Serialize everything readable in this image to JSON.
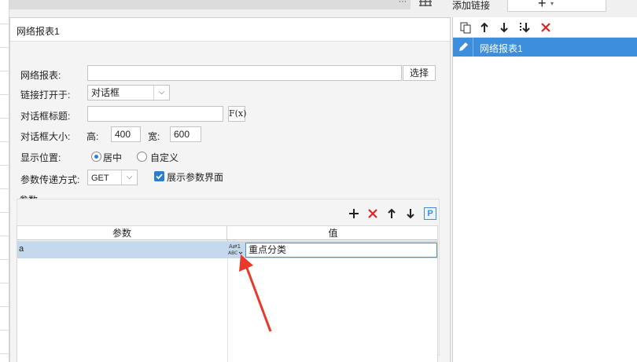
{
  "dialog": {
    "title": "网络报表1"
  },
  "form": {
    "report_label": "网络报表:",
    "report_value": "",
    "choose_button": "选择",
    "open_in_label": "链接打开于:",
    "open_in_value": "对话框",
    "dialog_title_label": "对话框标题:",
    "dialog_title_value": "",
    "fx_label": "F(x)",
    "dialog_size_label": "对话框大小:",
    "height_label": "高:",
    "height_value": "400",
    "width_label": "宽:",
    "width_value": "600",
    "position_label": "显示位置:",
    "position_center": "居中",
    "position_custom": "自定义",
    "param_method_label": "参数传递方式:",
    "param_method_value": "GET",
    "show_param_ui_label": "展示参数界面",
    "show_param_ui_checked": true
  },
  "params": {
    "section_label": "参数",
    "columns": [
      "参数",
      "值"
    ],
    "rows": [
      {
        "name": "a",
        "value": "重点分类"
      }
    ],
    "p_badge": "P"
  },
  "right_panel": {
    "title": "添加链接",
    "add_button": "+",
    "items": [
      {
        "label": "网络报表1",
        "selected": true
      }
    ]
  },
  "colors": {
    "accent": "#3d8fde",
    "selected_row": "#c5d9ec",
    "delete_red": "#e02424",
    "annotation_arrow": "#e8392b"
  }
}
